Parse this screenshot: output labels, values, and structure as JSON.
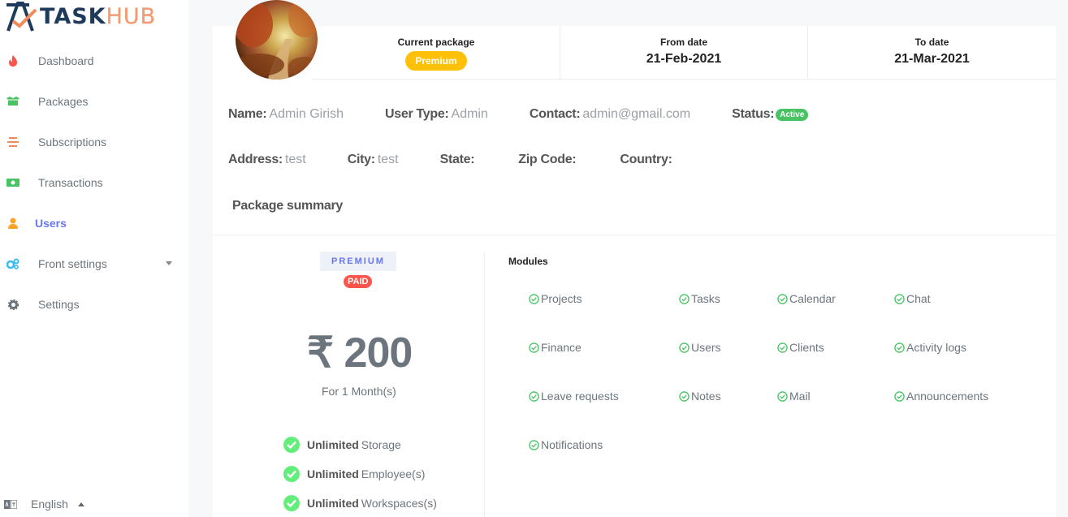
{
  "app": {
    "logo_main": "TASK",
    "logo_accent": "HUB"
  },
  "sidebar": {
    "items": [
      {
        "label": "Dashboard",
        "icon": "fire-icon",
        "color": "#fc544b"
      },
      {
        "label": "Packages",
        "icon": "box-icon",
        "color": "#47c363"
      },
      {
        "label": "Subscriptions",
        "icon": "list-icon",
        "color": "#f28a5a"
      },
      {
        "label": "Transactions",
        "icon": "money-icon",
        "color": "#47c363"
      },
      {
        "label": "Users",
        "icon": "user-icon",
        "color": "#ffa426",
        "active": true
      },
      {
        "label": "Front settings",
        "icon": "cogs-icon",
        "color": "#3abaf4"
      },
      {
        "label": "Settings",
        "icon": "gear-icon",
        "color": "#6c757d"
      }
    ],
    "language": "English"
  },
  "header": {
    "current_package_label": "Current package",
    "current_package_value": "Premium",
    "from_date_label": "From date",
    "from_date_value": "21-Feb-2021",
    "to_date_label": "To date",
    "to_date_value": "21-Mar-2021"
  },
  "user": {
    "name_label": "Name:",
    "name": "Admin Girish",
    "type_label": "User Type:",
    "type": "Admin",
    "contact_label": "Contact:",
    "contact": "admin@gmail.com",
    "status_label": "Status:",
    "status": "Active",
    "address_label": "Address:",
    "address": "test",
    "city_label": "City:",
    "city": "test",
    "state_label": "State:",
    "state": "",
    "zip_label": "Zip Code:",
    "zip": "",
    "country_label": "Country:",
    "country": ""
  },
  "summary": {
    "title": "Package summary",
    "plan": "PREMIUM",
    "paid": "PAID",
    "price": "₹ 200",
    "duration": "For 1 Month(s)",
    "features": [
      {
        "bold": "Unlimited",
        "text": "Storage"
      },
      {
        "bold": "Unlimited",
        "text": "Employee(s)"
      },
      {
        "bold": "Unlimited",
        "text": "Workspaces(s)"
      }
    ]
  },
  "modules": {
    "title": "Modules",
    "items": [
      "Projects",
      "Tasks",
      "Calendar",
      "Chat",
      "Finance",
      "Users",
      "Clients",
      "Activity logs",
      "Leave requests",
      "Notes",
      "Mail",
      "Announcements",
      "Notifications"
    ]
  },
  "colors": {
    "accent": "#6777ef",
    "success": "#47c363",
    "warning": "#ffc107",
    "danger": "#fc544b"
  }
}
